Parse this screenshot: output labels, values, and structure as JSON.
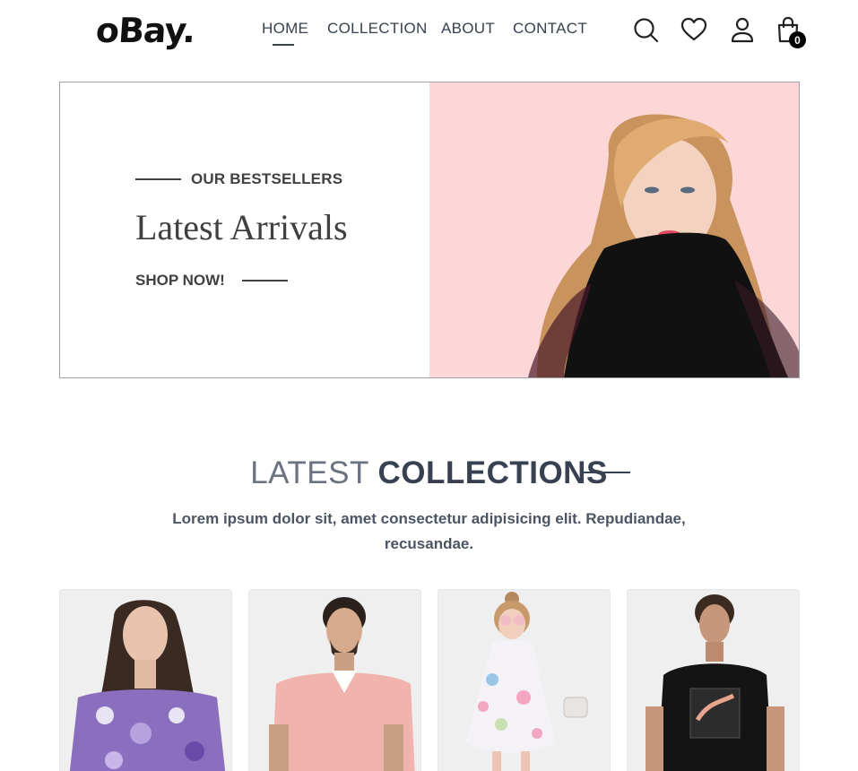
{
  "brand": {
    "logo": "oBay."
  },
  "nav": {
    "items": [
      {
        "label": "HOME",
        "active": true
      },
      {
        "label": "COLLECTION"
      },
      {
        "label": "ABOUT"
      },
      {
        "label": "CONTACT"
      }
    ]
  },
  "header_icons": [
    "search-icon",
    "heart-icon",
    "user-icon",
    "cart-icon"
  ],
  "cart": {
    "count": "0"
  },
  "hero": {
    "eyebrow": "OUR BESTSELLERS",
    "title": "Latest Arrivals",
    "cta": "SHOP NOW!"
  },
  "collections": {
    "title_light": "LATEST",
    "title_bold": "COLLECTIONS",
    "description": "Lorem ipsum dolor sit, amet consectetur adipisicing elit. Repudiandae, recusandae."
  },
  "products": [
    {
      "image": "woman-floral-off-shoulder-top"
    },
    {
      "image": "man-pink-polo-shirt"
    },
    {
      "image": "girl-floral-dress"
    },
    {
      "image": "man-black-tshirt"
    }
  ],
  "colors": {
    "hero_bg": "#fdd7d7",
    "text_dark": "#374151",
    "text_muted": "#6b7280",
    "badge": "#000000"
  }
}
